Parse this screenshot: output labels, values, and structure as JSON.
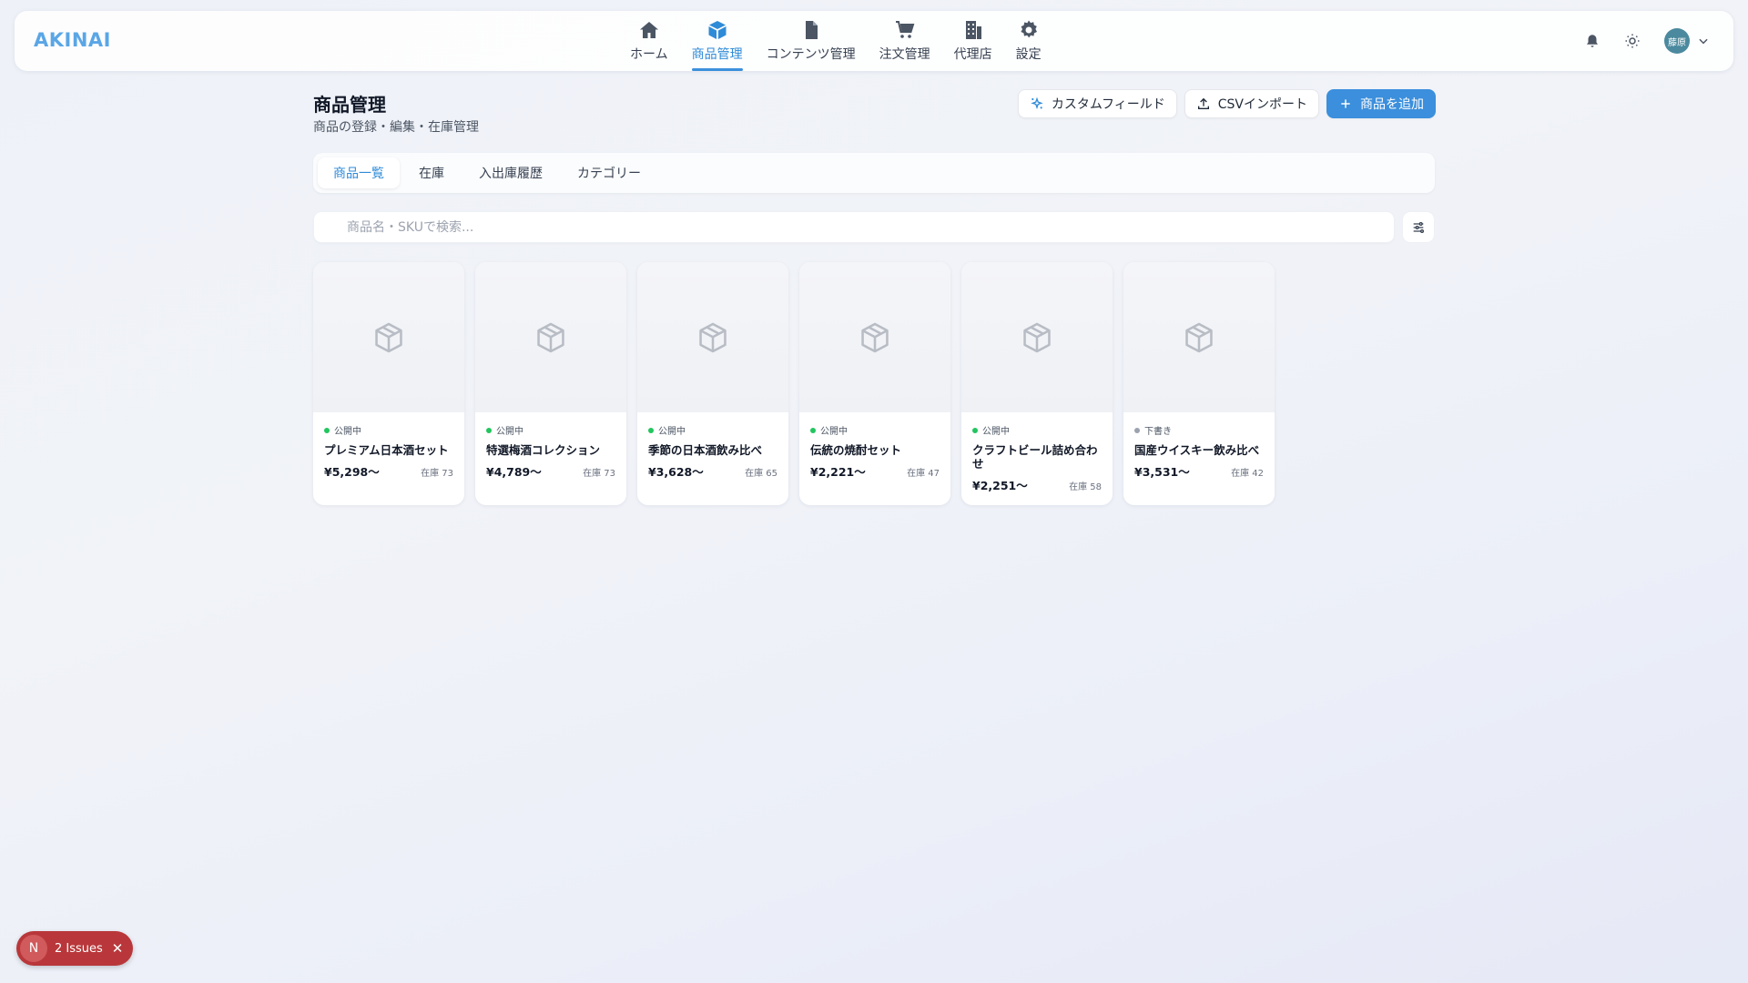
{
  "app": {
    "logo": "AKINAI"
  },
  "nav": [
    {
      "label": "ホーム",
      "icon": "home-icon"
    },
    {
      "label": "商品管理",
      "icon": "box-icon",
      "active": true
    },
    {
      "label": "コンテンツ管理",
      "icon": "document-icon"
    },
    {
      "label": "注文管理",
      "icon": "cart-icon"
    },
    {
      "label": "代理店",
      "icon": "building-icon"
    },
    {
      "label": "設定",
      "icon": "gear-icon"
    }
  ],
  "user": {
    "avatar_text": "藤原"
  },
  "header": {
    "title": "商品管理",
    "subtitle": "商品の登録・編集・在庫管理"
  },
  "actions": {
    "custom_fields": "カスタムフィールド",
    "csv_import": "CSVインポート",
    "add_product": "商品を追加"
  },
  "tabs": [
    {
      "label": "商品一覧",
      "active": true
    },
    {
      "label": "在庫"
    },
    {
      "label": "入出庫履歴"
    },
    {
      "label": "カテゴリー"
    }
  ],
  "search": {
    "placeholder": "商品名・SKUで検索..."
  },
  "products": [
    {
      "status": "公開中",
      "status_color": "#22c55e",
      "name": "プレミアム日本酒セット",
      "price": "¥5,298〜",
      "stock": "在庫 73"
    },
    {
      "status": "公開中",
      "status_color": "#22c55e",
      "name": "特選梅酒コレクション",
      "price": "¥4,789〜",
      "stock": "在庫 73"
    },
    {
      "status": "公開中",
      "status_color": "#22c55e",
      "name": "季節の日本酒飲み比べ",
      "price": "¥3,628〜",
      "stock": "在庫 65"
    },
    {
      "status": "公開中",
      "status_color": "#22c55e",
      "name": "伝統の焼酎セット",
      "price": "¥2,221〜",
      "stock": "在庫 47"
    },
    {
      "status": "公開中",
      "status_color": "#22c55e",
      "name": "クラフトビール詰め合わせ",
      "price": "¥2,251〜",
      "stock": "在庫 58"
    },
    {
      "status": "下書き",
      "status_color": "#9ca3af",
      "name": "国産ウイスキー飲み比べ",
      "price": "¥3,531〜",
      "stock": "在庫 42"
    }
  ],
  "issues": {
    "badge": "N",
    "label": "2 Issues"
  },
  "colors": {
    "accent": "#3b8fdc",
    "issues": "#b9373a"
  }
}
